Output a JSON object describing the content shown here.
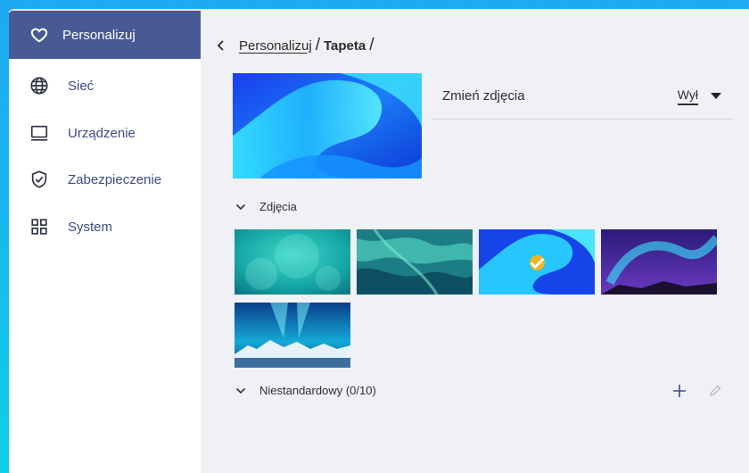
{
  "sidebar": {
    "items": [
      {
        "label": "Personalizuj",
        "icon": "heart-icon",
        "active": true
      },
      {
        "label": "Sieć",
        "icon": "globe-icon",
        "active": false
      },
      {
        "label": "Urządzenie",
        "icon": "monitor-icon",
        "active": false
      },
      {
        "label": "Zabezpieczenie",
        "icon": "shield-check-icon",
        "active": false
      },
      {
        "label": "System",
        "icon": "grid-icon",
        "active": false
      }
    ]
  },
  "breadcrumb": {
    "parent": "Personalizuj",
    "separator": "/",
    "current": "Tapeta"
  },
  "settings": {
    "change_photos_label": "Zmień zdjęcia",
    "change_photos_value": "Wył"
  },
  "sections": {
    "photos_label": "Zdjęcia",
    "custom_label": "Niestandardowy (0/10)"
  },
  "wallpapers": [
    {
      "name": "teal-bokeh",
      "selected": false
    },
    {
      "name": "teal-marble",
      "selected": false
    },
    {
      "name": "blue-wave",
      "selected": true
    },
    {
      "name": "purple-aurora",
      "selected": false
    },
    {
      "name": "aurora-mountains",
      "selected": false
    }
  ],
  "colors": {
    "accent": "#485a94",
    "nav_text": "#3d4a86",
    "check": "#f2b522",
    "background_panel": "#f0f1f4"
  }
}
